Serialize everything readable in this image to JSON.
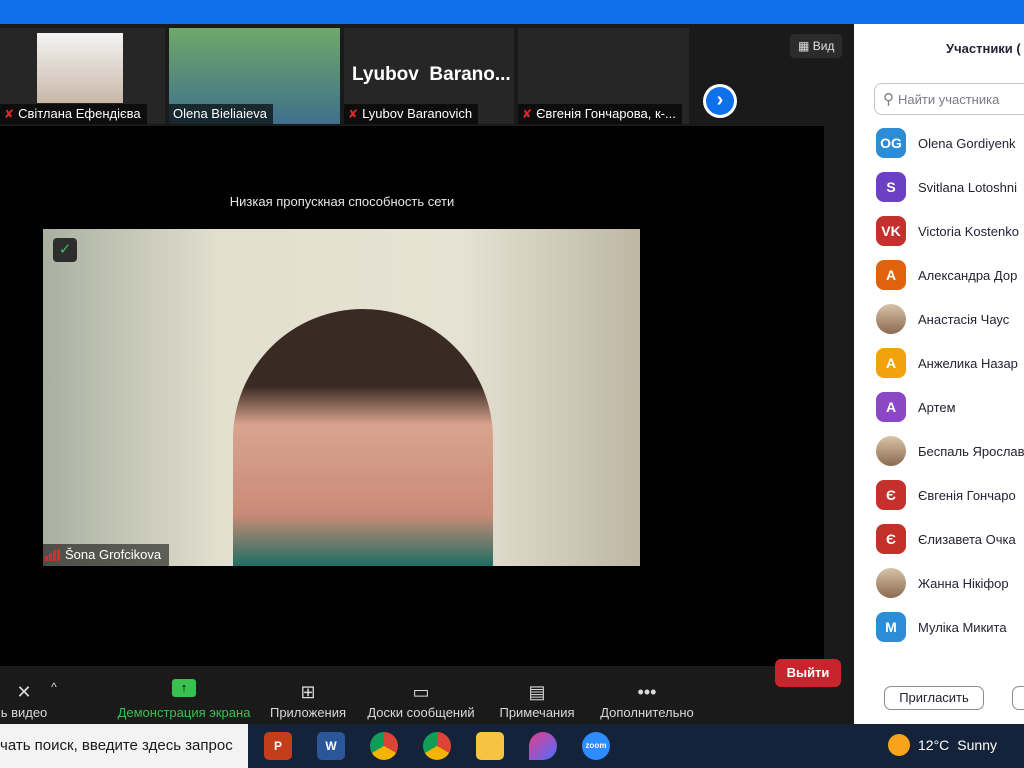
{
  "meeting": {
    "view_label": "Вид",
    "warning": "Низкая пропускная способность сети",
    "thumbnails": [
      {
        "name": "Світлана Ефендієва",
        "muted": true
      },
      {
        "name": "Olena Bieliaieva",
        "muted": false
      },
      {
        "name": "Lyubov Baranovich",
        "muted": true,
        "display_name": "Lyubov  Barano..."
      },
      {
        "name": "Євгенія Гончарова, к-...",
        "muted": true
      }
    ],
    "main_speaker": {
      "name": "Šona Grofcikova"
    }
  },
  "toolbar": {
    "video_label": "ь видео",
    "share_label": "Демонстрация экрана",
    "apps_label": "Приложения",
    "whiteboards_label": "Доски сообщений",
    "notes_label": "Примечания",
    "more_label": "Дополнительно",
    "leave_label": "Выйти"
  },
  "participants_panel": {
    "title": "Участники (",
    "search_placeholder": "Найти участника",
    "invite_label": "Пригласить",
    "items": [
      {
        "initials": "OG",
        "name": "Olena Gordiyenk",
        "color": "#2d8cd6"
      },
      {
        "initials": "S",
        "name": "Svitlana Lotoshni",
        "color": "#6c3fc4"
      },
      {
        "initials": "VK",
        "name": "Victoria Kostenko",
        "color": "#c4302b"
      },
      {
        "initials": "А",
        "name": "Александра Дор",
        "color": "#e0620d"
      },
      {
        "initials": "",
        "name": "Анастасія Чаус",
        "color": "photo"
      },
      {
        "initials": "А",
        "name": "Анжелика Назар",
        "color": "#f2a20c"
      },
      {
        "initials": "А",
        "name": "Артем",
        "color": "#8b47c4"
      },
      {
        "initials": "",
        "name": "Беспаль Ярослав",
        "color": "photo"
      },
      {
        "initials": "Є",
        "name": "Євгенія Гончаро",
        "color": "#c4302b"
      },
      {
        "initials": "Є",
        "name": "Єлизавета Очка",
        "color": "#c4302b"
      },
      {
        "initials": "",
        "name": "Жанна Нікіфор",
        "color": "photo"
      },
      {
        "initials": "М",
        "name": "Муліка Микита",
        "color": "#2d8cd6"
      }
    ]
  },
  "taskbar": {
    "search_text": "чать поиск, введите здесь запрос",
    "apps": [
      "P",
      "W",
      "chrome",
      "chrome-2",
      "folder",
      "paint",
      "zoom"
    ],
    "zoom_label": "zoom",
    "weather": {
      "temp": "12°C",
      "condition": "Sunny"
    }
  }
}
